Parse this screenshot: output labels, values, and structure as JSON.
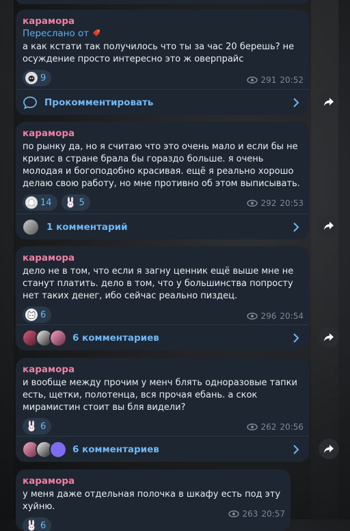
{
  "theme": {
    "accent": "#6fb7f5",
    "author_color": "#f07fa5",
    "bubble": "#1e2731"
  },
  "messages": [
    {
      "author": "карамора",
      "forwarded": "Переслано от",
      "text": "а как кстати так получилось что ты за час 20 берешь? не осуждение просто интересно это ж оверпрайс",
      "reactions": [
        {
          "icon": "cat-sticker",
          "count": "9"
        }
      ],
      "views": "291",
      "time": "20:52",
      "comments": "Прокомментировать"
    },
    {
      "author": "карамора",
      "text": "по рынку да, но я считаю что это очень мало и если бы не кризис в стране брала бы гораздо больше. я очень молодая и богоподобно красивая. ещё я реально хорошо делаю свою работу, но мне противно об этом выписывать.",
      "reactions": [
        {
          "icon": "ghost-sticker",
          "count": "14"
        },
        {
          "icon": "bunny-sticker",
          "count": "5"
        }
      ],
      "views": "292",
      "time": "20:53",
      "comments": "1 комментарий"
    },
    {
      "author": "карамора",
      "text": "дело не в том, что если я загну ценник ещё выше мне не станут платить. дело в том, что у большинства попросту нет таких денег, ибо сейчас реально пиздец.",
      "reactions": [
        {
          "icon": "kitty-sticker",
          "count": "6"
        }
      ],
      "views": "296",
      "time": "20:54",
      "comments": "6 комментариев"
    },
    {
      "author": "карамора",
      "text": "и вообще между прочим у менч блять одноразовые тапки есть, щетки, полотенца, вся прочая ебань. а скок мирамистин стоит вы бля видели?",
      "reactions": [
        {
          "icon": "bunny-sticker",
          "count": "6"
        }
      ],
      "views": "262",
      "time": "20:56",
      "comments": "6 комментариев"
    },
    {
      "author": "карамора",
      "text": "у меня даже отдельная полочка в шкафу есть под эту хуйню.",
      "reactions": [
        {
          "icon": "bunny-sticker",
          "count": "6"
        }
      ],
      "views": "263",
      "time": "20:57"
    }
  ]
}
